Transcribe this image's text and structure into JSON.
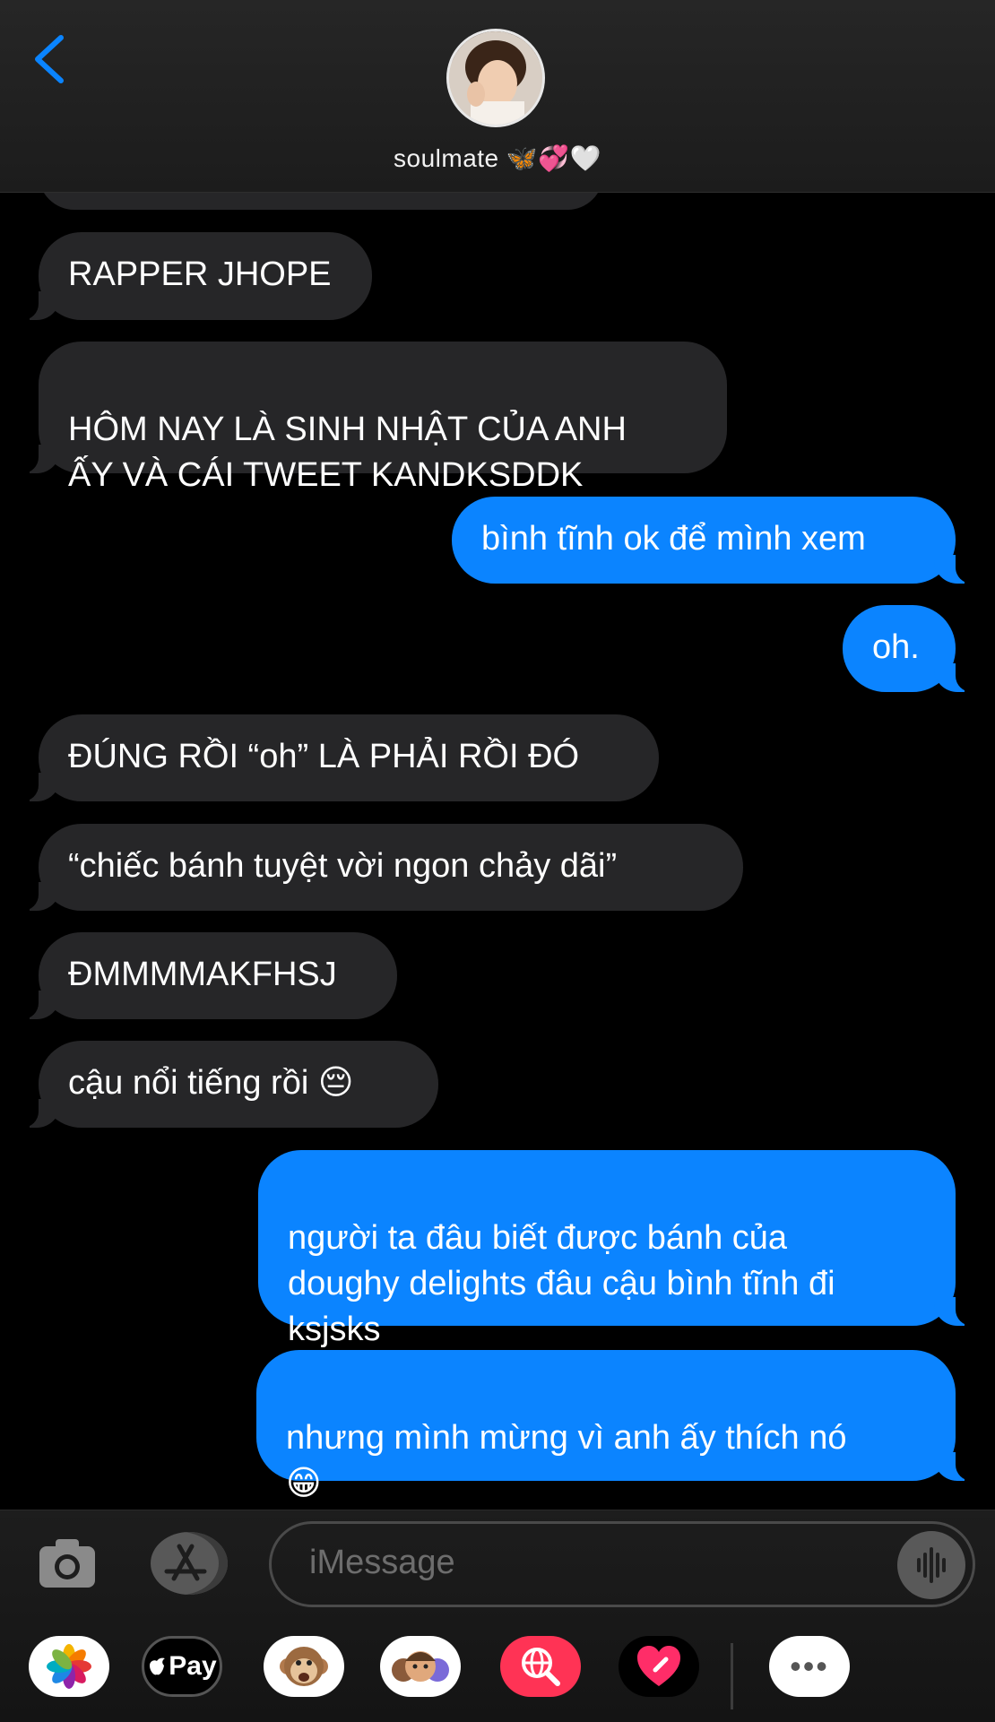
{
  "header": {
    "contact_name": "soulmate 🦋💞🤍"
  },
  "messages": [
    {
      "dir": "in",
      "text": "RAPPER JHOPE"
    },
    {
      "dir": "in",
      "text": "HÔM NAY LÀ SINH NHẬT CỦA ANH\nẤY VÀ CÁI TWEET KANDKSDDK"
    },
    {
      "dir": "out",
      "text": "bình tĩnh ok để mình xem"
    },
    {
      "dir": "out",
      "text": "oh."
    },
    {
      "dir": "in",
      "text": "ĐÚNG RỒI “oh” LÀ PHẢI RỒI ĐÓ"
    },
    {
      "dir": "in",
      "text": "“chiếc bánh tuyệt vời ngon chảy dãi”"
    },
    {
      "dir": "in",
      "text": "ĐMMMMAKFHSJ"
    },
    {
      "dir": "in",
      "text": "cậu nổi tiếng rồi 😔"
    },
    {
      "dir": "out",
      "text": "người ta đâu biết được bánh của\ndoughy delights đâu cậu bình tĩnh đi\nksjsks"
    },
    {
      "dir": "out",
      "text": "nhưng mình mừng vì anh ấy thích nó\n😁"
    }
  ],
  "composer": {
    "placeholder": "iMessage",
    "apps": [
      "photos",
      "apple-pay",
      "animoji",
      "memoji",
      "web-search",
      "digital-touch",
      "more"
    ],
    "apple_pay_label": "Pay",
    "more_label": "•••"
  },
  "colors": {
    "incoming_bubble": "#262628",
    "outgoing_bubble": "#0b84ff",
    "accent": "#0a84ff"
  }
}
